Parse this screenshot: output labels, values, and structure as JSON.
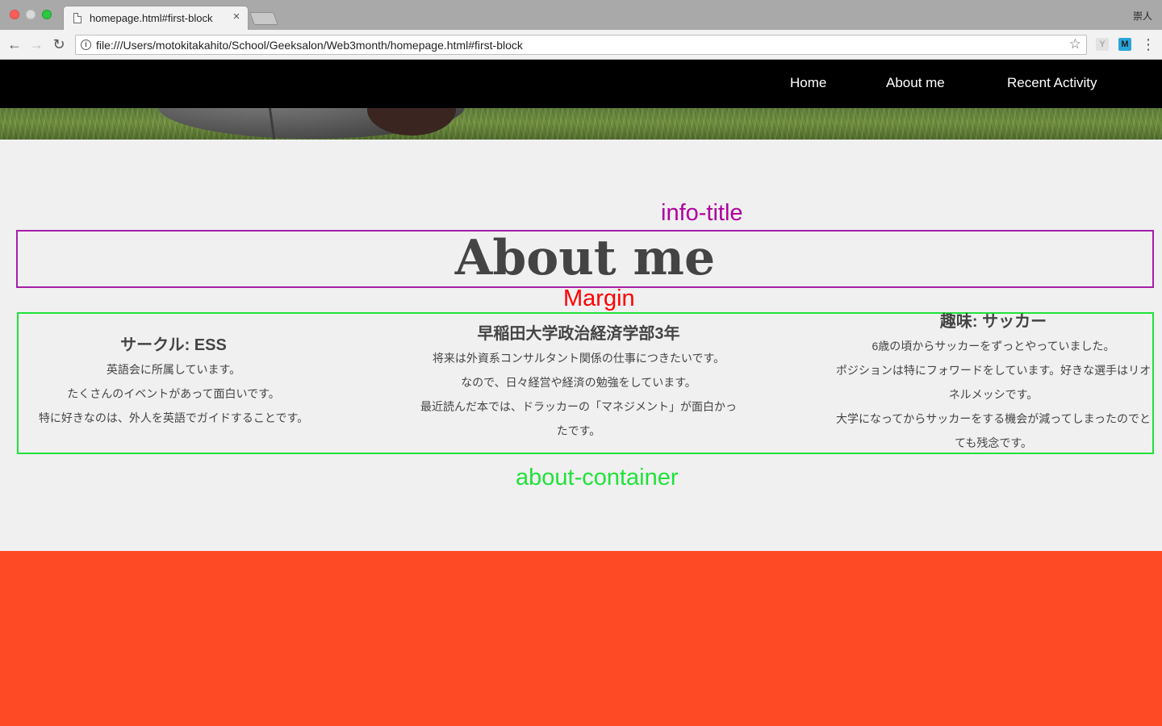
{
  "browser": {
    "tab_title": "homepage.html#first-block",
    "tab_close": "×",
    "profile_name": "崇人",
    "url": "file:///Users/motokitakahito/School/Geeksalon/Web3month/homepage.html#first-block",
    "info_glyph": "i",
    "star_glyph": "☆",
    "back_glyph": "←",
    "forward_glyph": "→",
    "reload_glyph": "↻",
    "menu_glyph": "⋮",
    "extensions": [
      "Y",
      "M"
    ]
  },
  "site_nav": {
    "items": [
      "Home",
      "About me",
      "Recent Activity"
    ]
  },
  "annotations": {
    "info_title": "info-title",
    "margin": "Margin",
    "about_container": "about-container",
    "colors": {
      "info_title": "#b0009f",
      "margin": "#ff0000",
      "about_container": "#1fe23a"
    }
  },
  "about": {
    "title": "About me",
    "columns": [
      {
        "heading": "サークル: ESS",
        "lines": [
          "英語会に所属しています。",
          "たくさんのイベントがあって面白いです。",
          "特に好きなのは、外人を英語でガイドすることです。"
        ]
      },
      {
        "heading": "早稲田大学政治経済学部3年",
        "lines": [
          "将来は外資系コンサルタント関係の仕事につきたいです。",
          "なので、日々経営や経済の勉強をしています。",
          "最近読んだ本では、ドラッカーの「マネジメント」が面白かっ",
          "たです。"
        ]
      },
      {
        "heading": "趣味: サッカー",
        "lines": [
          "6歳の頃からサッカーをずっとやっていました。",
          "ポジションは特にフォワードをしています。好きな選手はリオ",
          "ネルメッシです。",
          "大学になってからサッカーをする機会が減ってしまったのでと",
          "ても残念です。"
        ]
      }
    ]
  },
  "theme": {
    "nav_bg": "#000000",
    "page_bg": "#f0f0f0",
    "footer_bg": "#ff4a26"
  }
}
